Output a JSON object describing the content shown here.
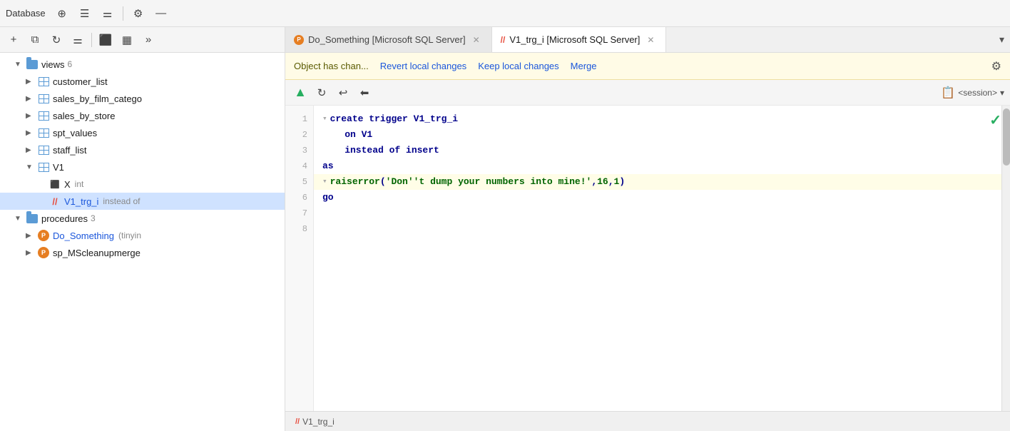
{
  "toolbar": {
    "label": "Database",
    "buttons": [
      {
        "name": "add-button",
        "icon": "⊕"
      },
      {
        "name": "format-button",
        "icon": "☰"
      },
      {
        "name": "format2-button",
        "icon": "⚌"
      },
      {
        "name": "settings-button",
        "icon": "⚙"
      },
      {
        "name": "minimize-button",
        "icon": "—"
      }
    ]
  },
  "sidebar": {
    "toolbar_buttons": [
      {
        "name": "add-item-button",
        "icon": "+"
      },
      {
        "name": "copy-button",
        "icon": "⧉"
      },
      {
        "name": "refresh-button",
        "icon": "↻"
      },
      {
        "name": "filter-button",
        "icon": "⚌"
      },
      {
        "name": "view-button",
        "icon": "⬛"
      },
      {
        "name": "table-button",
        "icon": "▦"
      },
      {
        "name": "more-button",
        "icon": "»"
      }
    ],
    "tree": [
      {
        "id": "views",
        "level": 1,
        "type": "folder",
        "label": "views",
        "badge": "6",
        "expanded": true,
        "arrow": "▼"
      },
      {
        "id": "customer_list",
        "level": 2,
        "type": "view",
        "label": "customer_list",
        "badge": "",
        "expanded": false,
        "arrow": "▶"
      },
      {
        "id": "sales_by_film_catego",
        "level": 2,
        "type": "view",
        "label": "sales_by_film_catego",
        "badge": "",
        "expanded": false,
        "arrow": "▶"
      },
      {
        "id": "sales_by_store",
        "level": 2,
        "type": "view",
        "label": "sales_by_store",
        "badge": "",
        "expanded": false,
        "arrow": "▶"
      },
      {
        "id": "spt_values",
        "level": 2,
        "type": "view",
        "label": "spt_values",
        "badge": "",
        "expanded": false,
        "arrow": "▶"
      },
      {
        "id": "staff_list",
        "level": 2,
        "type": "view",
        "label": "staff_list",
        "badge": "",
        "expanded": false,
        "arrow": "▶"
      },
      {
        "id": "V1",
        "level": 2,
        "type": "view",
        "label": "V1",
        "badge": "",
        "expanded": true,
        "arrow": "▼"
      },
      {
        "id": "V1_X",
        "level": 3,
        "type": "column",
        "label": "X",
        "meta": "int",
        "arrow": ""
      },
      {
        "id": "V1_trg_i",
        "level": 3,
        "type": "trigger",
        "label": "V1_trg_i",
        "meta": "instead of",
        "arrow": "",
        "selected": true
      },
      {
        "id": "procedures",
        "level": 1,
        "type": "folder",
        "label": "procedures",
        "badge": "3",
        "expanded": true,
        "arrow": "▼"
      },
      {
        "id": "Do_Something",
        "level": 2,
        "type": "procedure",
        "label": "Do_Something",
        "meta": "(tinyin",
        "arrow": "▶"
      },
      {
        "id": "sp_MScleanupmerge",
        "level": 2,
        "type": "procedure",
        "label": "sp_MScleanupmerge",
        "meta": "",
        "arrow": "▶"
      }
    ]
  },
  "tabs": [
    {
      "id": "do_something",
      "label": "Do_Something [Microsoft SQL Server]",
      "type": "procedure",
      "active": false,
      "closable": true
    },
    {
      "id": "v1_trg_i",
      "label": "V1_trg_i [Microsoft SQL Server]",
      "type": "trigger",
      "active": true,
      "closable": true
    }
  ],
  "tabs_chevron": "▾",
  "notification": {
    "text": "Object has chan...",
    "revert_label": "Revert local changes",
    "keep_label": "Keep local changes",
    "merge_label": "Merge",
    "settings_icon": "⚙"
  },
  "editor_toolbar": {
    "buttons": [
      {
        "name": "run-button",
        "icon": "▲",
        "color": "green"
      },
      {
        "name": "refresh-btn",
        "icon": "↻"
      },
      {
        "name": "undo-button",
        "icon": "↩"
      },
      {
        "name": "navigate-button",
        "icon": "⬅"
      }
    ],
    "session_label": "<session>",
    "session_chevron": "▾"
  },
  "code": {
    "lines": [
      {
        "num": 1,
        "tokens": [
          {
            "type": "fold",
            "text": "▾"
          },
          {
            "type": "kw",
            "text": "create trigger"
          },
          {
            "type": "plain",
            "text": " V1_trg_i"
          }
        ],
        "highlighted": false
      },
      {
        "num": 2,
        "tokens": [
          {
            "type": "kw",
            "text": "    on"
          },
          {
            "type": "plain",
            "text": " V1"
          }
        ],
        "highlighted": false
      },
      {
        "num": 3,
        "tokens": [
          {
            "type": "kw",
            "text": "    instead of insert"
          }
        ],
        "highlighted": false
      },
      {
        "num": 4,
        "tokens": [
          {
            "type": "kw",
            "text": "as"
          }
        ],
        "highlighted": false
      },
      {
        "num": 5,
        "tokens": [
          {
            "type": "fold",
            "text": "▾"
          },
          {
            "type": "fn",
            "text": "raiserror"
          },
          {
            "type": "plain_dark",
            "text": "("
          },
          {
            "type": "str",
            "text": "'Don''t dump your numbers into mine!'"
          },
          {
            "type": "plain_dark",
            "text": ","
          },
          {
            "type": "num",
            "text": "16"
          },
          {
            "type": "plain_dark",
            "text": ","
          },
          {
            "type": "num",
            "text": "1"
          },
          {
            "type": "plain_dark",
            "text": ")"
          }
        ],
        "highlighted": true
      },
      {
        "num": 6,
        "tokens": [
          {
            "type": "kw",
            "text": "go"
          }
        ],
        "highlighted": false
      },
      {
        "num": 7,
        "tokens": [],
        "highlighted": false
      },
      {
        "num": 8,
        "tokens": [],
        "highlighted": false
      }
    ],
    "check_visible": true
  },
  "bottom_tab": {
    "trigger_icon": "//",
    "label": "V1_trg_i"
  }
}
